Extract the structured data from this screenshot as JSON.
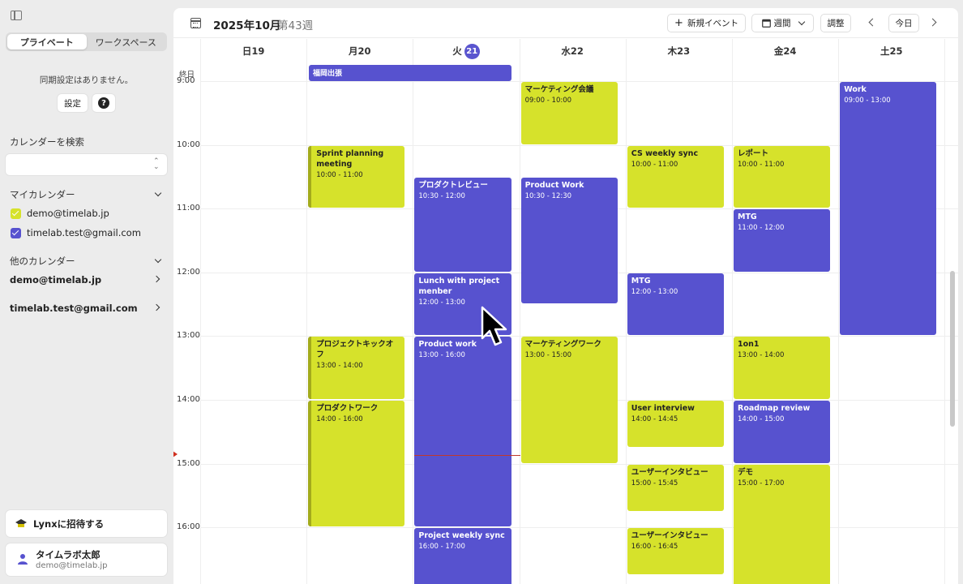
{
  "sidebar": {
    "tabs": [
      "プライベート",
      "ワークスペース"
    ],
    "sync_message": "同期設定はありません。",
    "settings_label": "設定",
    "search_label": "カレンダーを検索",
    "my_calendars_label": "マイカレンダー",
    "my_calendars": [
      {
        "name": "demo@timelab.jp",
        "color": "#d6e22b"
      },
      {
        "name": "timelab.test@gmail.com",
        "color": "#5752cf"
      }
    ],
    "other_calendars_label": "他のカレンダー",
    "other_calendars": [
      "demo@timelab.jp",
      "timelab.test@gmail.com"
    ],
    "invite_label": "Lynxに招待する",
    "user_name": "タイムラボ太郎",
    "user_email": "demo@timelab.jp"
  },
  "toolbar": {
    "month": "2025年10月",
    "week": "第43週",
    "new_event": "新規イベント",
    "view": "週間",
    "adjust": "調整",
    "today": "今日"
  },
  "days": [
    {
      "label": "日",
      "date": "19",
      "today": false
    },
    {
      "label": "月",
      "date": "20",
      "today": false
    },
    {
      "label": "火",
      "date": "21",
      "today": true
    },
    {
      "label": "水",
      "date": "22",
      "today": false
    },
    {
      "label": "木",
      "date": "23",
      "today": false
    },
    {
      "label": "金",
      "date": "24",
      "today": false
    },
    {
      "label": "土",
      "date": "25",
      "today": false
    }
  ],
  "allday_label": "終日",
  "allday_event": "福岡出張",
  "hours": [
    "9:00",
    "10:00",
    "11:00",
    "12:00",
    "13:00",
    "14:00",
    "15:00",
    "16:00"
  ],
  "colors": {
    "purple": "#5752cf",
    "yellow": "#d6e22b",
    "accent": "#5a55cf"
  },
  "events": [
    {
      "day": 3,
      "start": 9.0,
      "end": 10.0,
      "title": "マーケティング会議",
      "time": "09:00 - 10:00",
      "color": "yellow"
    },
    {
      "day": 6,
      "start": 9.0,
      "end": 13.0,
      "title": "Work",
      "time": "09:00 - 13:00",
      "color": "purple"
    },
    {
      "day": 1,
      "start": 10.0,
      "end": 11.0,
      "title": "Sprint planning meeting",
      "time": "10:00 - 11:00",
      "color": "yellow",
      "edge": true
    },
    {
      "day": 4,
      "start": 10.0,
      "end": 11.0,
      "title": "CS weekly sync",
      "time": "10:00 - 11:00",
      "color": "yellow"
    },
    {
      "day": 5,
      "start": 10.0,
      "end": 11.0,
      "title": "レポート",
      "time": "10:00 - 11:00",
      "color": "yellow"
    },
    {
      "day": 2,
      "start": 10.5,
      "end": 12.0,
      "title": "プロダクトレビュー",
      "time": "10:30 - 12:00",
      "color": "purple"
    },
    {
      "day": 3,
      "start": 10.5,
      "end": 12.5,
      "title": "Product Work",
      "time": "10:30 - 12:30",
      "color": "purple"
    },
    {
      "day": 5,
      "start": 11.0,
      "end": 12.0,
      "title": "MTG",
      "time": "11:00 - 12:00",
      "color": "purple"
    },
    {
      "day": 2,
      "start": 12.0,
      "end": 13.0,
      "title": "Lunch with project menber",
      "time": "12:00 - 13:00",
      "color": "purple"
    },
    {
      "day": 4,
      "start": 12.0,
      "end": 13.0,
      "title": "MTG",
      "time": "12:00 - 13:00",
      "color": "purple"
    },
    {
      "day": 1,
      "start": 13.0,
      "end": 14.0,
      "title": "プロジェクトキックオフ",
      "time": "13:00 - 14:00",
      "color": "yellow",
      "edge": true
    },
    {
      "day": 2,
      "start": 13.0,
      "end": 16.0,
      "title": "Product work",
      "time": "13:00 - 16:00",
      "color": "purple"
    },
    {
      "day": 3,
      "start": 13.0,
      "end": 15.0,
      "title": "マーケティングワーク",
      "time": "13:00 - 15:00",
      "color": "yellow"
    },
    {
      "day": 5,
      "start": 13.0,
      "end": 14.0,
      "title": "1on1",
      "time": "13:00 - 14:00",
      "color": "yellow"
    },
    {
      "day": 1,
      "start": 14.0,
      "end": 16.0,
      "title": "プロダクトワーク",
      "time": "14:00 - 16:00",
      "color": "yellow",
      "edge": true
    },
    {
      "day": 4,
      "start": 14.0,
      "end": 14.75,
      "title": "User interview",
      "time": "14:00 - 14:45",
      "color": "yellow"
    },
    {
      "day": 5,
      "start": 14.0,
      "end": 15.0,
      "title": "Roadmap review",
      "time": "14:00 - 15:00",
      "color": "purple"
    },
    {
      "day": 4,
      "start": 15.0,
      "end": 15.75,
      "title": "ユーザーインタビュー",
      "time": "15:00 - 15:45",
      "color": "yellow"
    },
    {
      "day": 5,
      "start": 15.0,
      "end": 17.0,
      "title": "デモ",
      "time": "15:00 - 17:00",
      "color": "yellow"
    },
    {
      "day": 2,
      "start": 16.0,
      "end": 17.0,
      "title": "Project weekly sync",
      "time": "16:00 - 17:00",
      "color": "purple"
    },
    {
      "day": 4,
      "start": 16.0,
      "end": 16.75,
      "title": "ユーザーインタビュー",
      "time": "16:00 - 16:45",
      "color": "yellow"
    }
  ]
}
